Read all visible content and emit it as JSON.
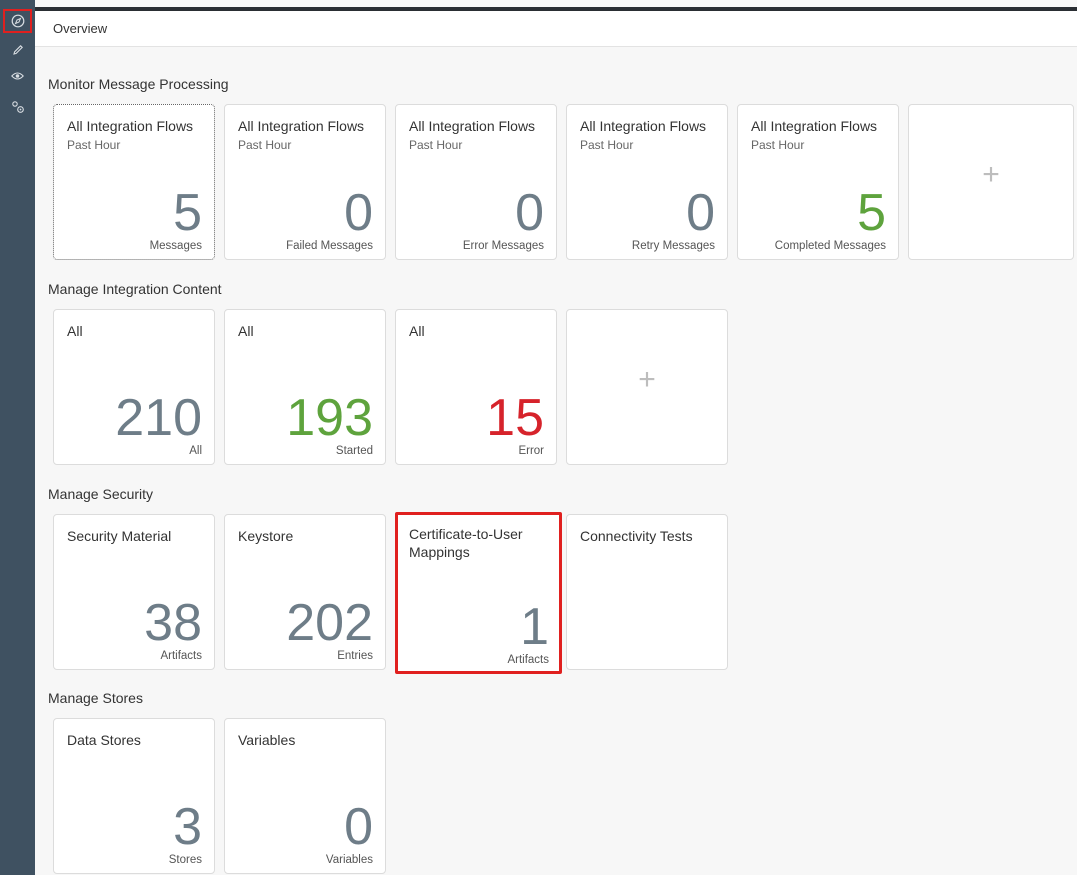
{
  "header": {
    "title": "Overview"
  },
  "sections": {
    "monitor": {
      "title": "Monitor Message Processing",
      "tiles": [
        {
          "title": "All Integration Flows",
          "sub": "Past Hour",
          "value": "5",
          "unit": "Messages"
        },
        {
          "title": "All Integration Flows",
          "sub": "Past Hour",
          "value": "0",
          "unit": "Failed Messages"
        },
        {
          "title": "All Integration Flows",
          "sub": "Past Hour",
          "value": "0",
          "unit": "Error Messages"
        },
        {
          "title": "All Integration Flows",
          "sub": "Past Hour",
          "value": "0",
          "unit": "Retry Messages"
        },
        {
          "title": "All Integration Flows",
          "sub": "Past Hour",
          "value": "5",
          "unit": "Completed Messages"
        }
      ],
      "add_label": "+"
    },
    "content": {
      "title": "Manage Integration Content",
      "tiles": [
        {
          "title": "All",
          "value": "210",
          "unit": "All"
        },
        {
          "title": "All",
          "value": "193",
          "unit": "Started"
        },
        {
          "title": "All",
          "value": "15",
          "unit": "Error"
        }
      ],
      "add_label": "+"
    },
    "security": {
      "title": "Manage Security",
      "tiles": [
        {
          "title": "Security Material",
          "value": "38",
          "unit": "Artifacts"
        },
        {
          "title": "Keystore",
          "value": "202",
          "unit": "Entries"
        },
        {
          "title": "Certificate-to-User Mappings",
          "value": "1",
          "unit": "Artifacts"
        },
        {
          "title": "Connectivity Tests"
        }
      ]
    },
    "stores": {
      "title": "Manage Stores",
      "tiles": [
        {
          "title": "Data Stores",
          "value": "3",
          "unit": "Stores"
        },
        {
          "title": "Variables",
          "value": "0",
          "unit": "Variables"
        }
      ]
    }
  },
  "colors": {
    "sidebar": "#3f5161",
    "number_default": "#6e7d88",
    "number_success": "#5ea33d",
    "number_error": "#d6232b",
    "highlight": "#e0201f"
  },
  "icons": {
    "sidebar": [
      "discover-icon",
      "edit-pencil-icon",
      "monitor-eye-icon",
      "settings-gears-icon"
    ]
  }
}
